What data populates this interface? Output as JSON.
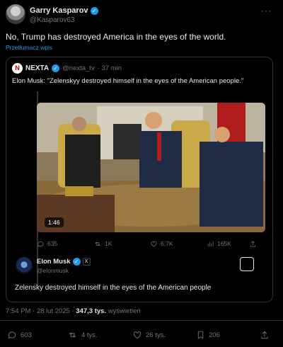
{
  "post": {
    "author_name": "Garry Kasparov",
    "author_handle": "@Kasparov63",
    "more_label": "···",
    "text": "No, Trump has destroyed America in the eyes of the world.",
    "translate_label": "Przetłumacz wpis",
    "timestamp": "7:54 PM · 28 lut 2025 · ",
    "views_count": "347,3 tys.",
    "views_label": " wyświetleń",
    "replies": "603",
    "reposts": "4 tys.",
    "likes": "26 tys.",
    "bookmarks": "206"
  },
  "quote": {
    "author_name": "NEXTA",
    "author_handle": "@nexta_tv",
    "time": "· 37 min",
    "logo_letter": "N",
    "text": "Elon Musk: \"Zelenskyy destroyed himself in the eyes of the American people.\"",
    "video_duration": "1:46",
    "replies": "635",
    "reposts": "1K",
    "likes": "6,7K",
    "views": "165K"
  },
  "embedded": {
    "author_name": "Elon Musk",
    "author_handle": "@elonmusk",
    "badge": "X",
    "text": "Zelensky destroyed himself in the eyes of the American people"
  },
  "colors": {
    "accent": "#1d9bf0",
    "muted": "#71767b",
    "border": "#2f3336",
    "background": "#000000"
  }
}
